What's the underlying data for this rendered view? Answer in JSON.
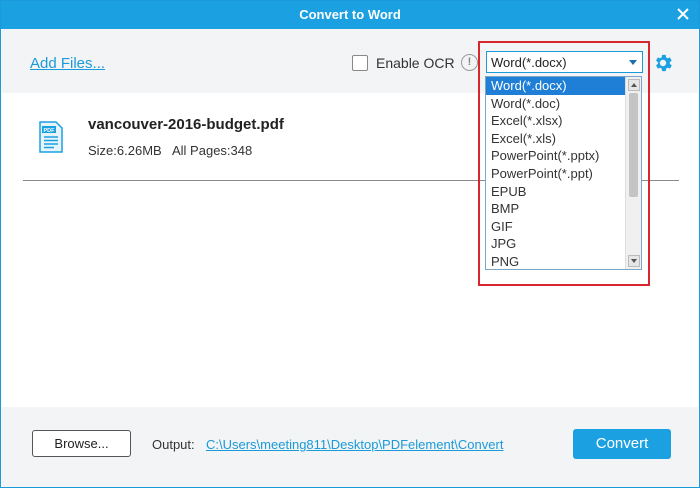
{
  "window": {
    "title": "Convert to Word"
  },
  "toolbar": {
    "add_files_label": "Add Files...",
    "ocr_label": "Enable OCR",
    "ocr_checked": false,
    "info_glyph": "!",
    "format_value": "Word(*.docx)"
  },
  "dropdown": {
    "options": [
      "Word(*.docx)",
      "Word(*.doc)",
      "Excel(*.xlsx)",
      "Excel(*.xls)",
      "PowerPoint(*.pptx)",
      "PowerPoint(*.ppt)",
      "EPUB",
      "BMP",
      "GIF",
      "JPG",
      "PNG"
    ],
    "selected_index": 0
  },
  "file": {
    "name": "vancouver-2016-budget.pdf",
    "size": "Size:6.26MB",
    "pages": "All Pages:348",
    "icon_text": "PDF"
  },
  "footer": {
    "browse_label": "Browse...",
    "output_label": "Output:",
    "output_path": "C:\\Users\\meeting811\\Desktop\\PDFelement\\Convert",
    "convert_label": "Convert"
  },
  "colors": {
    "accent": "#1ba0e2",
    "selection": "#1f7fd6",
    "highlight": "#d7262e"
  },
  "icons": [
    "close-icon",
    "info-icon",
    "gear-icon",
    "pdf-file-icon",
    "chevron-down-icon"
  ]
}
